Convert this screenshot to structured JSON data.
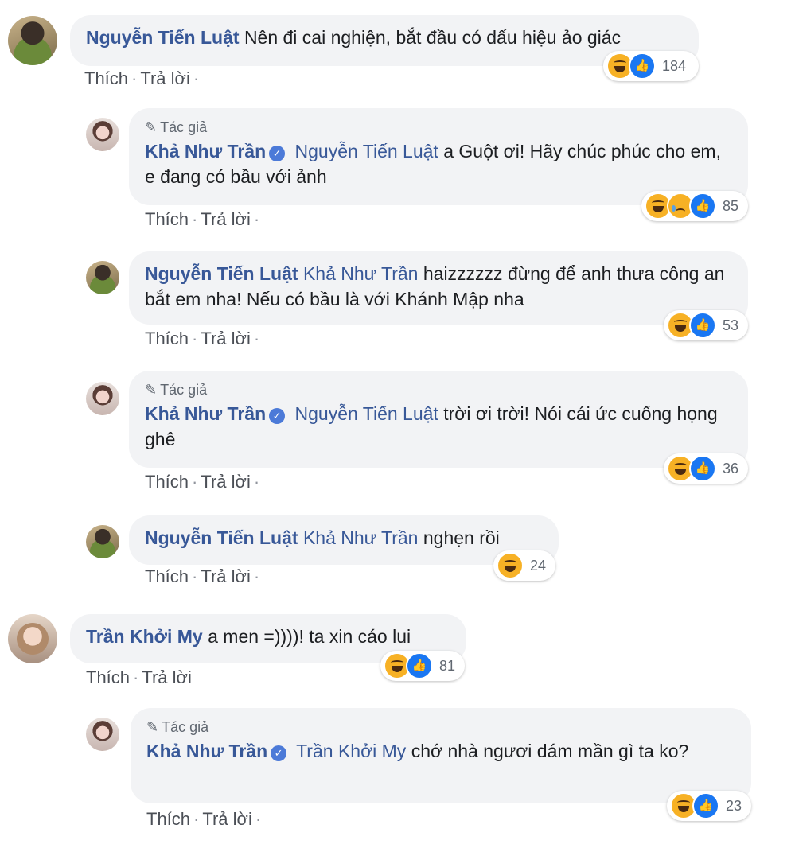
{
  "labels": {
    "like": "Thích",
    "reply": "Trả lời",
    "author": "Tác giả",
    "dot": "·"
  },
  "comments": [
    {
      "author": "Nguyễn Tiến Luật",
      "text": "Nên đi cai nghiện, bắt đầu có dấu hiệu ảo giác",
      "reactions": [
        "haha",
        "like"
      ],
      "count": "184"
    },
    {
      "author": "Khả Như Trần",
      "mention": "Nguyễn Tiến Luật",
      "text": "a Guột ơi! Hãy chúc phúc cho em, e đang có bầu với ảnh",
      "reactions": [
        "haha",
        "sad",
        "like"
      ],
      "count": "85"
    },
    {
      "author": "Nguyễn Tiến Luật",
      "mention": "Khả Như Trần",
      "text": "haizzzzzz đừng để anh thưa công an bắt em nha! Nếu có bầu là với Khánh Mập nha",
      "reactions": [
        "haha",
        "like"
      ],
      "count": "53"
    },
    {
      "author": "Khả Như Trần",
      "mention": "Nguyễn Tiến Luật",
      "text": "trời ơi trời! Nói cái ức cuống họng ghê",
      "reactions": [
        "haha",
        "like"
      ],
      "count": "36"
    },
    {
      "author": "Nguyễn Tiến Luật",
      "mention": "Khả Như Trần",
      "text": "nghẹn rồi",
      "reactions": [
        "haha"
      ],
      "count": "24"
    },
    {
      "author": "Trần Khởi My",
      "text": "a men =))))! ta xin cáo lui",
      "reactions": [
        "haha",
        "like"
      ],
      "count": "81"
    },
    {
      "author": "Khả Như Trần",
      "mention": "Trần Khởi My",
      "text": "chớ nhà ngươi dám mần gì ta ko?",
      "reactions": [
        "haha",
        "like"
      ],
      "count": "23"
    }
  ],
  "icons": {
    "verified": "verified-check-icon",
    "pen": "pen-icon",
    "haha": "haha-reaction-icon",
    "like": "like-reaction-icon",
    "sad": "sad-reaction-icon"
  },
  "colors": {
    "name": "#385898",
    "bubble": "#f2f3f5",
    "like": "#1a77f2",
    "haha": "#f7b125"
  }
}
